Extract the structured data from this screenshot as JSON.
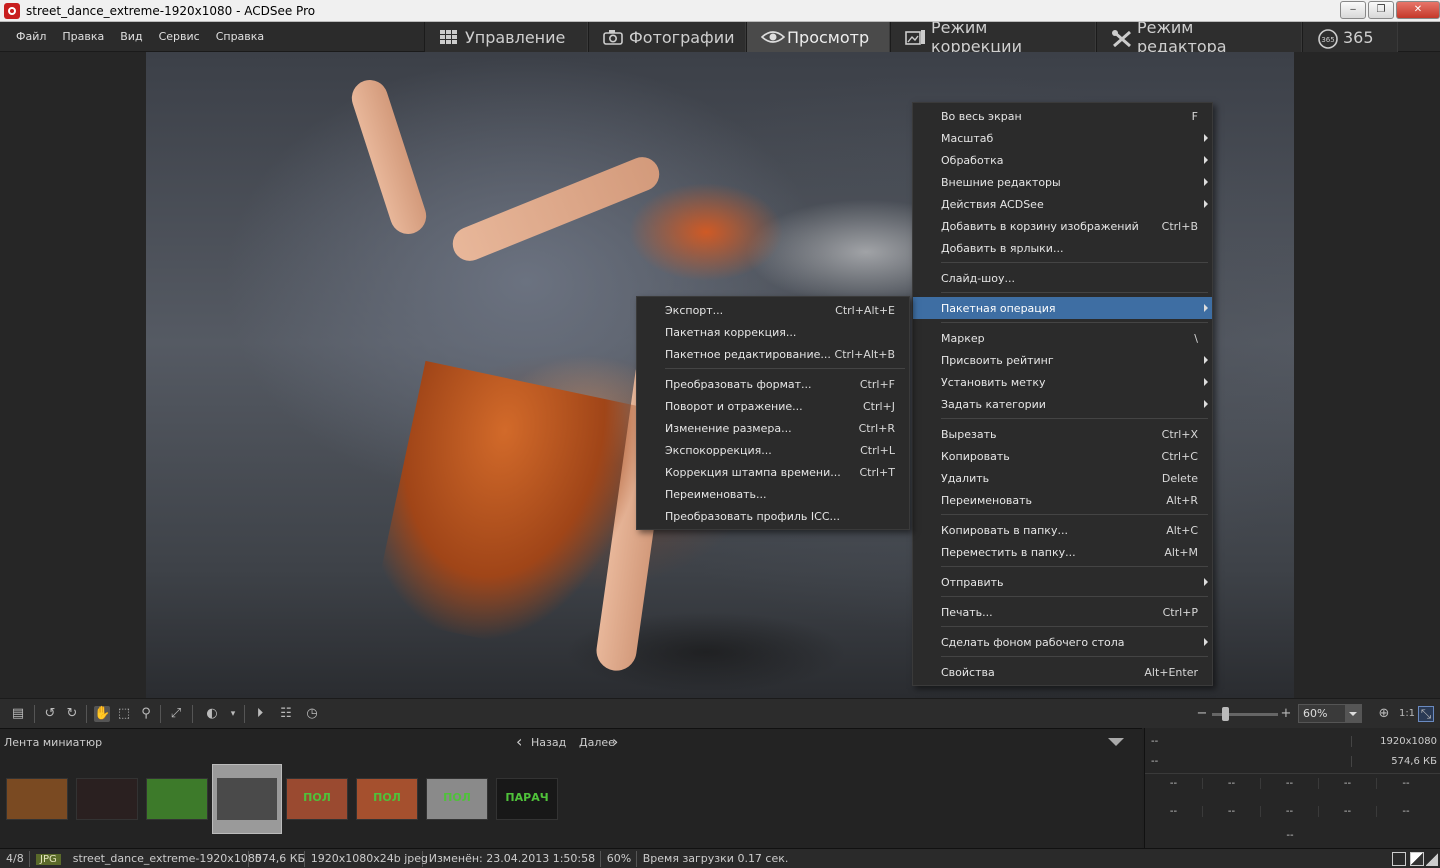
{
  "window": {
    "title": "street_dance_extreme-1920x1080 - ACDSee Pro",
    "minimize": "‒",
    "restore": "❐",
    "close": "✕"
  },
  "menubar": [
    "Файл",
    "Правка",
    "Вид",
    "Сервис",
    "Справка"
  ],
  "modes": [
    {
      "label": "Управление",
      "icon": "grid-icon",
      "active": false
    },
    {
      "label": "Фотографии",
      "icon": "camera-icon",
      "active": false
    },
    {
      "label": "Просмотр",
      "icon": "eye-icon",
      "active": true
    },
    {
      "label": "Режим коррекции",
      "icon": "develop-icon",
      "active": false
    },
    {
      "label": "Режим редактора",
      "icon": "edit-tools-icon",
      "active": false
    },
    {
      "label": "365",
      "icon": "365-icon",
      "active": false
    }
  ],
  "context_menu": {
    "items": [
      {
        "label": "Во весь экран",
        "shortcut": "F"
      },
      {
        "label": "Масштаб",
        "submenu": true
      },
      {
        "label": "Обработка",
        "submenu": true
      },
      {
        "label": "Внешние редакторы",
        "submenu": true
      },
      {
        "label": "Действия ACDSee",
        "submenu": true
      },
      {
        "label": "Добавить в корзину изображений",
        "shortcut": "Ctrl+B"
      },
      {
        "label": "Добавить в ярлыки..."
      },
      {
        "sep": true
      },
      {
        "label": "Слайд-шоу..."
      },
      {
        "sep": true
      },
      {
        "label": "Пакетная операция",
        "submenu": true,
        "highlight": true
      },
      {
        "sep": true
      },
      {
        "label": "Маркер",
        "shortcut": "\\"
      },
      {
        "label": "Присвоить рейтинг",
        "submenu": true
      },
      {
        "label": "Установить метку",
        "submenu": true
      },
      {
        "label": "Задать категории",
        "submenu": true
      },
      {
        "sep": true
      },
      {
        "label": "Вырезать",
        "shortcut": "Ctrl+X"
      },
      {
        "label": "Копировать",
        "shortcut": "Ctrl+C"
      },
      {
        "label": "Удалить",
        "shortcut": "Delete"
      },
      {
        "label": "Переименовать",
        "shortcut": "Alt+R"
      },
      {
        "sep": true
      },
      {
        "label": "Копировать в папку...",
        "shortcut": "Alt+C"
      },
      {
        "label": "Переместить в папку...",
        "shortcut": "Alt+M"
      },
      {
        "sep": true
      },
      {
        "label": "Отправить",
        "submenu": true
      },
      {
        "sep": true
      },
      {
        "label": "Печать...",
        "shortcut": "Ctrl+P"
      },
      {
        "sep": true
      },
      {
        "label": "Сделать фоном рабочего стола",
        "submenu": true
      },
      {
        "sep": true
      },
      {
        "label": "Свойства",
        "shortcut": "Alt+Enter"
      }
    ]
  },
  "batch_submenu": {
    "items": [
      {
        "label": "Экспорт...",
        "shortcut": "Ctrl+Alt+E"
      },
      {
        "label": "Пакетная коррекция..."
      },
      {
        "label": "Пакетное редактирование...",
        "shortcut": "Ctrl+Alt+B"
      },
      {
        "sep": true
      },
      {
        "label": "Преобразовать формат...",
        "shortcut": "Ctrl+F"
      },
      {
        "label": "Поворот и отражение...",
        "shortcut": "Ctrl+J"
      },
      {
        "label": "Изменение размера...",
        "shortcut": "Ctrl+R"
      },
      {
        "label": "Экспокоррекция...",
        "shortcut": "Ctrl+L"
      },
      {
        "label": "Коррекция штампа времени...",
        "shortcut": "Ctrl+T"
      },
      {
        "label": "Переименовать..."
      },
      {
        "label": "Преобразовать профиль ICC..."
      }
    ]
  },
  "toolbar": {
    "zoom_value": "60%",
    "one_to_one": "1:1",
    "zoom_minus": "−",
    "zoom_plus": "+"
  },
  "filmstrip": {
    "title": "Лента миниатюр",
    "back": "Назад",
    "next": "Далее",
    "thumbnails": [
      {
        "color": "#7a4a22",
        "label": ""
      },
      {
        "color": "#2a2020",
        "label": ""
      },
      {
        "color": "#3d7a2a",
        "label": ""
      },
      {
        "color": "#4a4a4a",
        "label": ""
      },
      {
        "color": "#9a4a30",
        "label": "ПОЛ"
      },
      {
        "color": "#a5502e",
        "label": "ПОЛ"
      },
      {
        "color": "#8a8a8a",
        "label": "ПОЛ"
      },
      {
        "color": "#181818",
        "label": "ПАРАЧ"
      }
    ]
  },
  "info_panel": {
    "row1_left": "--",
    "row1_right": "1920x1080",
    "row2_left": "--",
    "row2_right": "574,6 КБ",
    "cell": "--"
  },
  "status": {
    "position": "4/8",
    "format": "JPG",
    "filename": "street_dance_extreme-1920x1080",
    "size": "574,6 КБ",
    "dimensions": "1920x1080x24b jpeg",
    "modified": "Изменён: 23.04.2013 1:50:58",
    "zoom": "60%",
    "load_time": "Время загрузки 0.17 сек."
  },
  "colors": {
    "highlight": "#3e6ea3",
    "menu_bg": "#2b2b2b",
    "format_badge": "#5a6a2a"
  }
}
